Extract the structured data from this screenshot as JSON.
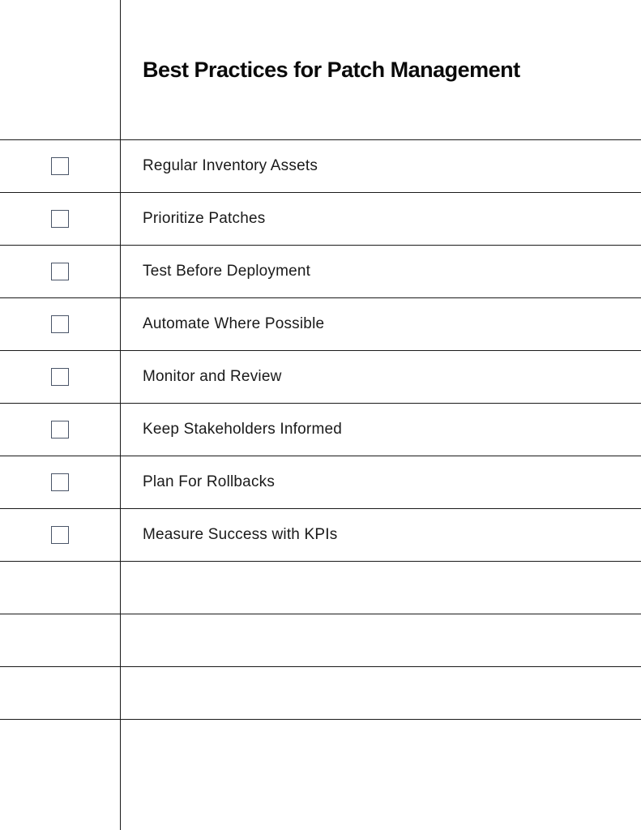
{
  "title": "Best Practices for Patch Management",
  "items": [
    {
      "label": "Regular Inventory Assets",
      "checked": false
    },
    {
      "label": "Prioritize Patches",
      "checked": false
    },
    {
      "label": "Test Before Deployment",
      "checked": false
    },
    {
      "label": "Automate Where Possible",
      "checked": false
    },
    {
      "label": "Monitor and Review",
      "checked": false
    },
    {
      "label": "Keep Stakeholders Informed",
      "checked": false
    },
    {
      "label": "Plan For Rollbacks",
      "checked": false
    },
    {
      "label": "Measure Success with KPIs",
      "checked": false
    }
  ],
  "empty_rows": 4
}
